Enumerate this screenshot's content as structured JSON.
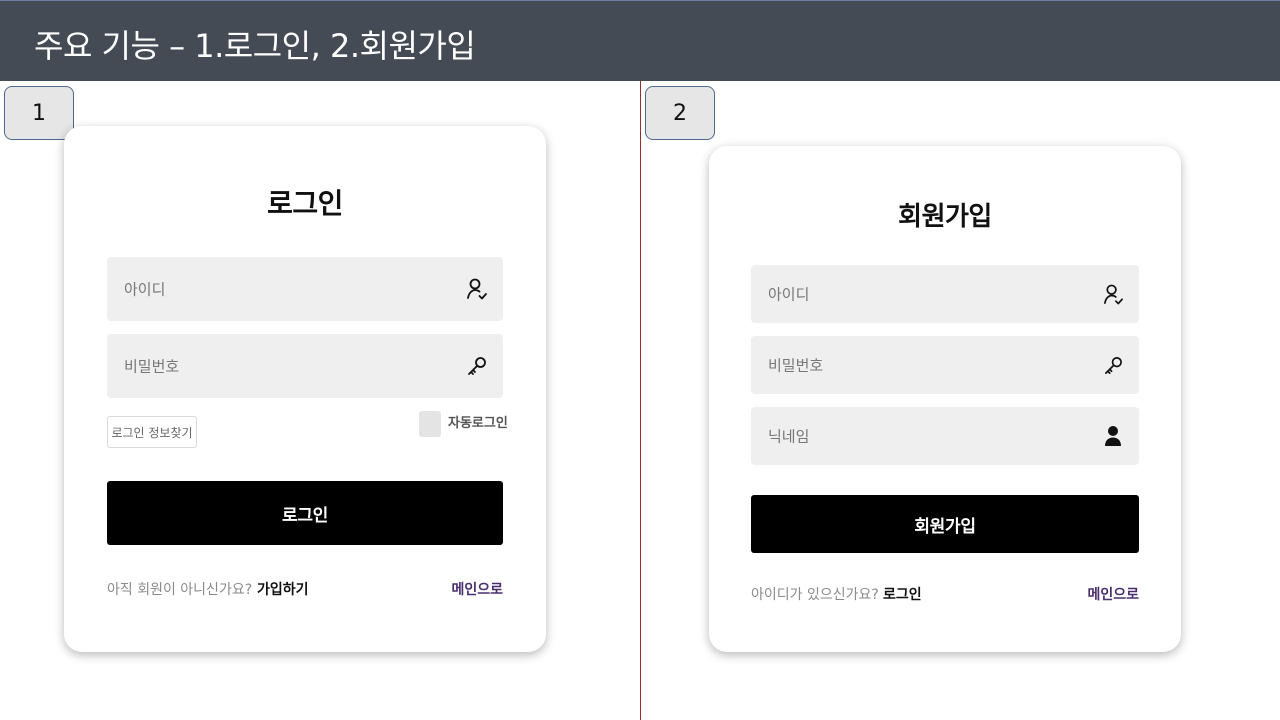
{
  "header": {
    "title": "주요 기능 – 1.로그인,  2.회원가입"
  },
  "colors": {
    "header_bg": "#454b55",
    "divider": "#9b2d2d",
    "accent_link": "#4a2f6e",
    "button": "#000000"
  },
  "login": {
    "badge": "1",
    "title": "로그인",
    "id_placeholder": "아이디",
    "id_icon": "user-check-icon",
    "password_placeholder": "비밀번호",
    "password_icon": "key-icon",
    "find_info_label": "로그인 정보찾기",
    "auto_login_label": "자동로그인",
    "auto_login_checked": false,
    "submit_label": "로그인",
    "footer_question": "아직 회원이 아니신가요?",
    "footer_link": "가입하기",
    "main_link": "메인으로"
  },
  "signup": {
    "badge": "2",
    "title": "회원가입",
    "id_placeholder": "아이디",
    "id_icon": "user-check-icon",
    "password_placeholder": "비밀번호",
    "password_icon": "key-icon",
    "nickname_placeholder": "닉네임",
    "nickname_icon": "person-icon",
    "submit_label": "회원가입",
    "footer_question": "아이디가 있으신가요?",
    "footer_link": "로그인",
    "main_link": "메인으로"
  }
}
